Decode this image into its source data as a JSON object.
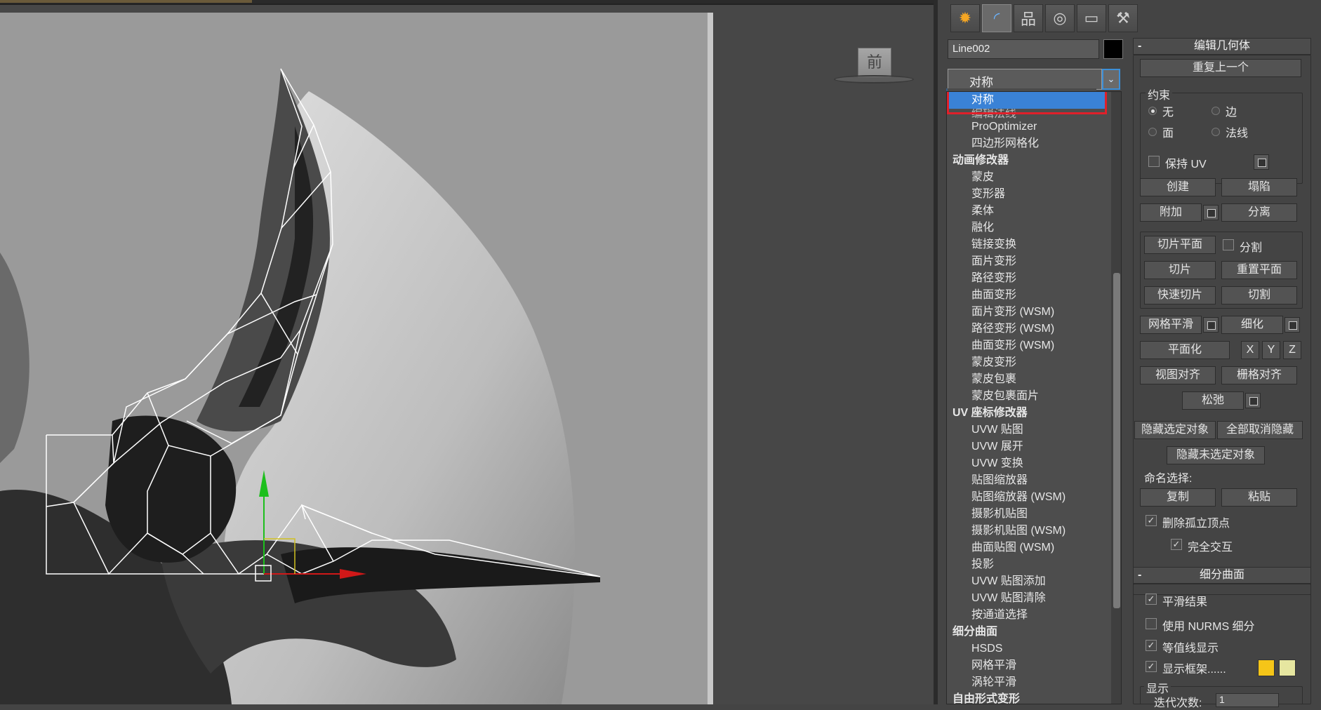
{
  "viewport": {
    "label": "前",
    "progress_percent": 27
  },
  "command_panel": {
    "tabs": [
      {
        "name": "create",
        "icon": "create-star-icon",
        "glyph": "✹"
      },
      {
        "name": "modify",
        "icon": "modify-curve-icon",
        "glyph": "◜"
      },
      {
        "name": "hierarchy",
        "icon": "hierarchy-icon",
        "glyph": "品"
      },
      {
        "name": "motion",
        "icon": "motion-icon",
        "glyph": "◎"
      },
      {
        "name": "display",
        "icon": "display-monitor-icon",
        "glyph": "▭"
      },
      {
        "name": "utilities",
        "icon": "utilities-hammer-icon",
        "glyph": "⚒"
      }
    ],
    "object_name": "Line002",
    "object_color": "#000000",
    "modifier_combo_value": "对称",
    "combo_arrow": "⌄"
  },
  "dropdown": {
    "items": [
      {
        "text": "对称",
        "type": "sel"
      },
      {
        "text": "编辑法线",
        "type": "partial"
      },
      {
        "text": "ProOptimizer",
        "type": "item"
      },
      {
        "text": "四边形网格化",
        "type": "item"
      },
      {
        "text": "动画修改器",
        "type": "cat"
      },
      {
        "text": "蒙皮",
        "type": "item"
      },
      {
        "text": "变形器",
        "type": "item"
      },
      {
        "text": "柔体",
        "type": "item"
      },
      {
        "text": "融化",
        "type": "item"
      },
      {
        "text": "链接变换",
        "type": "item"
      },
      {
        "text": "面片变形",
        "type": "item"
      },
      {
        "text": "路径变形",
        "type": "item"
      },
      {
        "text": "曲面变形",
        "type": "item"
      },
      {
        "text": "面片变形 (WSM)",
        "type": "item"
      },
      {
        "text": "路径变形 (WSM)",
        "type": "item"
      },
      {
        "text": "曲面变形 (WSM)",
        "type": "item"
      },
      {
        "text": "蒙皮变形",
        "type": "item"
      },
      {
        "text": "蒙皮包裹",
        "type": "item"
      },
      {
        "text": "蒙皮包裹面片",
        "type": "item"
      },
      {
        "text": "UV 座标修改器",
        "type": "cat"
      },
      {
        "text": "UVW 贴图",
        "type": "item"
      },
      {
        "text": "UVW 展开",
        "type": "item"
      },
      {
        "text": "UVW 变换",
        "type": "item"
      },
      {
        "text": "贴图缩放器",
        "type": "item"
      },
      {
        "text": "贴图缩放器 (WSM)",
        "type": "item"
      },
      {
        "text": "摄影机贴图",
        "type": "item"
      },
      {
        "text": "摄影机贴图 (WSM)",
        "type": "item"
      },
      {
        "text": "曲面贴图 (WSM)",
        "type": "item"
      },
      {
        "text": "投影",
        "type": "item"
      },
      {
        "text": "UVW 贴图添加",
        "type": "item"
      },
      {
        "text": "UVW 贴图清除",
        "type": "item"
      },
      {
        "text": "按通道选择",
        "type": "item"
      },
      {
        "text": "细分曲面",
        "type": "cat"
      },
      {
        "text": "HSDS",
        "type": "item"
      },
      {
        "text": "网格平滑",
        "type": "item"
      },
      {
        "text": "涡轮平滑",
        "type": "item"
      },
      {
        "text": "自由形式变形",
        "type": "cat"
      }
    ]
  },
  "edit_geometry": {
    "title": "编辑几何体",
    "collapse": "-",
    "repeat_last": "重复上一个",
    "constraints": {
      "title": "约束",
      "none": "无",
      "edge": "边",
      "face": "面",
      "normal": "法线"
    },
    "preserve_uv": "保持 UV",
    "create": "创建",
    "collapse_btn": "塌陷",
    "attach": "附加",
    "detach": "分离",
    "slice_plane": "切片平面",
    "split": "分割",
    "slice": "切片",
    "reset_plane": "重置平面",
    "quick_slice": "快速切片",
    "cut": "切割",
    "meshsmooth": "网格平滑",
    "tessellate": "细化",
    "make_planar": "平面化",
    "x": "X",
    "y": "Y",
    "z": "Z",
    "view_align": "视图对齐",
    "grid_align": "栅格对齐",
    "relax": "松弛",
    "hide_selected": "隐藏选定对象",
    "unhide_all": "全部取消隐藏",
    "hide_unselected": "隐藏未选定对象",
    "named_selections": "命名选择:",
    "copy": "复制",
    "paste": "粘贴",
    "delete_isolated": "删除孤立顶点",
    "full_interactivity": "完全交互",
    "check": "✓"
  },
  "subdivision_surface": {
    "title": "细分曲面",
    "collapse": "-",
    "smooth_result": "平滑结果",
    "use_nurms": "使用 NURMS 细分",
    "isoline_display": "等值线显示",
    "show_cage": "显示框架......",
    "cage_color_1": "#f5c518",
    "cage_color_2": "#e6e6a0",
    "display_group": "显示",
    "iterations_label": "迭代次数:",
    "iterations_value": "1",
    "check": "✓"
  }
}
